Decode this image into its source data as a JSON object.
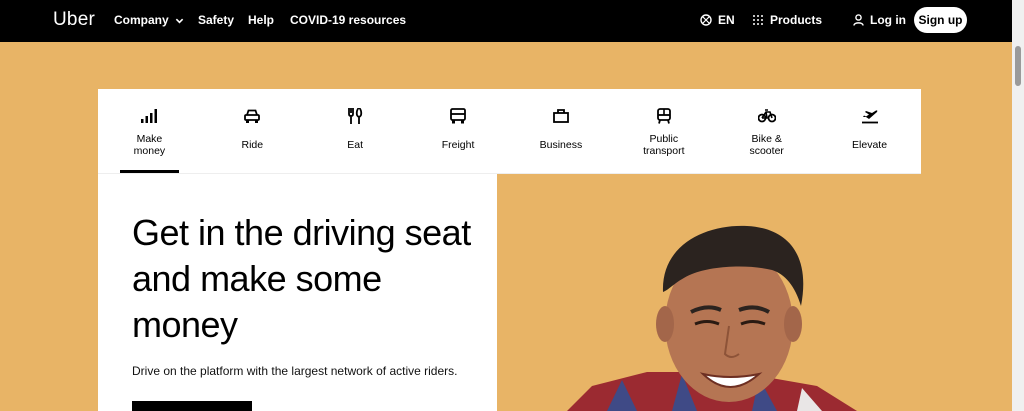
{
  "nav": {
    "logo": "Uber",
    "company": "Company",
    "safety": "Safety",
    "help": "Help",
    "covid": "COVID-19 resources",
    "language": "EN",
    "products": "Products",
    "login": "Log in",
    "signup": "Sign up"
  },
  "tabs": [
    {
      "label": "Make money",
      "icon": "signal-bars-icon",
      "active": true
    },
    {
      "label": "Ride",
      "icon": "car-icon"
    },
    {
      "label": "Eat",
      "icon": "fork-knife-icon"
    },
    {
      "label": "Freight",
      "icon": "truck-icon"
    },
    {
      "label": "Business",
      "icon": "briefcase-icon"
    },
    {
      "label": "Public transport",
      "icon": "bus-icon"
    },
    {
      "label": "Bike & scooter",
      "icon": "bicycle-icon"
    },
    {
      "label": "Elevate",
      "icon": "airplane-icon"
    }
  ],
  "hero": {
    "headline": "Get in the driving seat and make some money",
    "subtext": "Drive on the platform with the largest network of active riders."
  },
  "colors": {
    "nav_bg": "#000000",
    "hero_bg": "#e8b466"
  }
}
